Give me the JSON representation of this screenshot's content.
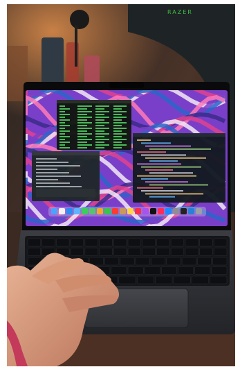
{
  "scene": {
    "brand_logo_text": "RAZER",
    "colors": {
      "room_bg": "#3a2e2a",
      "wall_warm": "#c06a3c",
      "chair": "#1e2326",
      "laptop_body": "#2b2d31",
      "keyboard": "#15161a",
      "key": "#0e0f12",
      "trackpad": "#3a3c41",
      "screen_bezel": "#0a0a0c",
      "wallpaper_pink": "#e0428f",
      "wallpaper_purple": "#7a3fc8",
      "wallpaper_blue": "#2a66c9",
      "wallpaper_white": "#f2e9f3",
      "terminal_bg": "#10160f",
      "terminal_text": "#57e26a",
      "editor_bg": "#141a22",
      "hand": "#d99a7a",
      "desk": "#4a2f22"
    },
    "dock_icons": [
      "finder-icon",
      "launchpad-icon",
      "safari-icon",
      "mail-icon",
      "messages-icon",
      "maps-icon",
      "photos-icon",
      "facetime-icon",
      "calendar-icon",
      "contacts-icon",
      "notes-icon",
      "music-icon",
      "podcasts-icon",
      "tv-icon",
      "news-icon",
      "appstore-icon",
      "settings-icon",
      "terminal-icon",
      "vscode-icon",
      "trash-icon"
    ]
  }
}
